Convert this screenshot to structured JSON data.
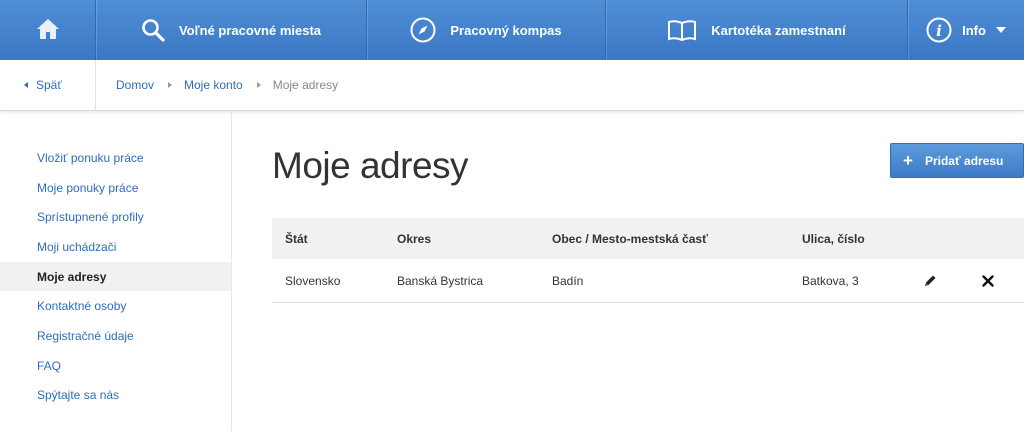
{
  "topnav": {
    "home_icon": "home-icon",
    "items": [
      {
        "label": "Voľné pracovné miesta",
        "icon": "search-icon"
      },
      {
        "label": "Pracovný kompas",
        "icon": "compass-icon"
      },
      {
        "label": "Kartotéka zamestnaní",
        "icon": "book-icon"
      },
      {
        "label": "Info",
        "icon": "info-icon"
      }
    ]
  },
  "breadcrumb": {
    "back_label": "Späť",
    "items": [
      "Domov",
      "Moje konto",
      "Moje adresy"
    ]
  },
  "sidebar": {
    "items": [
      {
        "label": "Vložiť ponuku práce"
      },
      {
        "label": "Moje ponuky práce"
      },
      {
        "label": "Sprístupnené profily"
      },
      {
        "label": "Moji uchádzači"
      },
      {
        "label": "Moje adresy",
        "active": true
      },
      {
        "label": "Kontaktné osoby"
      },
      {
        "label": "Registračné údaje"
      },
      {
        "label": "FAQ"
      },
      {
        "label": "Spýtajte sa nás"
      }
    ]
  },
  "main": {
    "title": "Moje adresy",
    "add_button": "Pridať adresu",
    "table": {
      "headers": [
        "Štát",
        "Okres",
        "Obec / Mesto-mestská časť",
        "Ulica, číslo"
      ],
      "rows": [
        {
          "stat": "Slovensko",
          "okres": "Banská Bystrica",
          "obec": "Badín",
          "ulica": "Batkova, 3",
          "edit_icon": "pencil-icon",
          "delete_icon": "close-icon"
        }
      ]
    }
  },
  "colors": {
    "nav_blue": "#3f7dc9",
    "link_blue": "#2f6db8"
  }
}
